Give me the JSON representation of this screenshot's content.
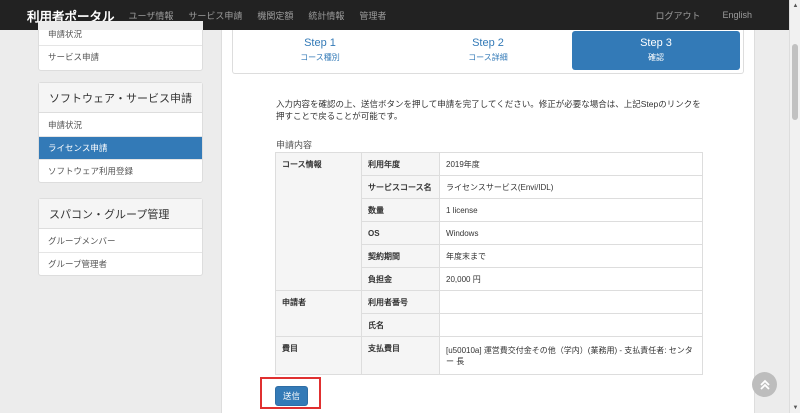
{
  "navbar": {
    "brand": "利用者ポータル",
    "items": [
      "ユーザ情報",
      "サービス申請",
      "機関定額",
      "統計情報",
      "管理者"
    ],
    "logout": "ログアウト",
    "language": "English"
  },
  "sidebar": {
    "panel1": {
      "items": [
        "申請状況",
        "サービス申請"
      ]
    },
    "panel2": {
      "title": "ソフトウェア・サービス申請",
      "items": [
        "申請状況",
        "ライセンス申請",
        "ソフトウェア利用登録"
      ]
    },
    "panel3": {
      "title": "スパコン・グループ管理",
      "items": [
        "グループメンバー",
        "グループ管理者"
      ]
    }
  },
  "steps": [
    {
      "title": "Step 1",
      "sub": "コース種別"
    },
    {
      "title": "Step 2",
      "sub": "コース詳細"
    },
    {
      "title": "Step 3",
      "sub": "確認"
    }
  ],
  "intro": "入力内容を確認の上、送信ボタンを押して申請を完了してください。修正が必要な場合は、上記Stepのリンクを押すことで戻ることが可能です。",
  "section_label": "申請内容",
  "course": {
    "group": "コース情報",
    "rows": [
      {
        "key": "利用年度",
        "value": "2019年度"
      },
      {
        "key": "サービスコース名",
        "value": "ライセンスサービス(Envi/IDL)"
      },
      {
        "key": "数量",
        "value": "1 license"
      },
      {
        "key": "OS",
        "value": "Windows"
      },
      {
        "key": "契約期間",
        "value": "年度末まで"
      },
      {
        "key": "負担金",
        "value": "20,000 円"
      }
    ]
  },
  "applicant": {
    "group": "申請者",
    "rows": [
      {
        "key": "利用者番号",
        "value": ""
      },
      {
        "key": "氏名",
        "value": ""
      }
    ]
  },
  "expense": {
    "group": "費目",
    "key": "支払費目",
    "value": "[u50010a] 運営費交付金その他（学内）(業務用) - 支払責任者: センター 長"
  },
  "submit_label": "送信",
  "colors": {
    "navbar": "#222222",
    "primary": "#337ab7",
    "highlight": "#e03030"
  }
}
